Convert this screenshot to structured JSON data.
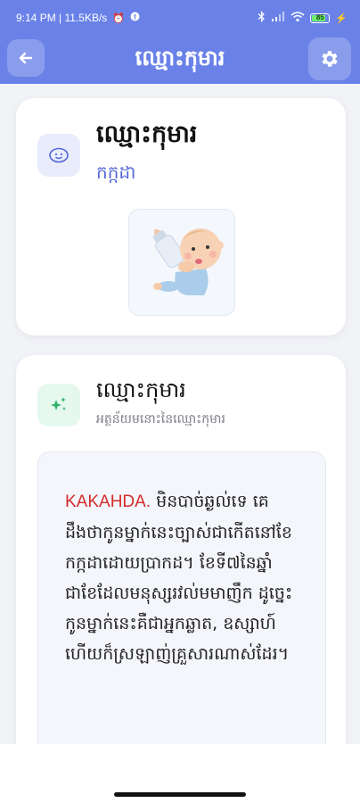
{
  "status_bar": {
    "left_text": "9:14 PM | 11.5KB/s",
    "battery_level": "85",
    "icons": [
      "alarm-icon",
      "facebook-icon",
      "bluetooth-icon",
      "signal-icon",
      "wifi-icon",
      "battery-icon",
      "charging-icon"
    ]
  },
  "app_bar": {
    "title": "ឈ្មោះកុមារ",
    "back_icon": "arrow-left-icon",
    "settings_icon": "gear-icon"
  },
  "name_card": {
    "name": "ឈ្មោះកុមារ",
    "month": "កក្កដា",
    "icon": "face-icon",
    "image": "baby-with-bottle"
  },
  "meaning_card": {
    "title": "ឈ្មោះកុមារ",
    "subtitle": "អត្ថន័យមនោះនៃឈ្មោះកុមារ",
    "icon": "sparkle-icon",
    "keyword": "KAKAHDA.",
    "text": " មិនបាច់ឆ្ងល់ទេ គេដឹងថាកូនម្នាក់នេះច្បាស់ជាកើតនៅខែកក្កដាដោយប្រាកដ។ ខែទី៧នៃឆ្នាំ ជាខែដែលមនុស្សរវល់មមាញឹក ដូច្នេះកូនម្នាក់នេះគឺជាអ្នកឆ្លាត, ឧស្សាហ៍ហើយក៏ស្រឡាញ់គ្រួសារណាស់ដែរ។"
  },
  "colors": {
    "primary": "#6a82e8",
    "accent_text": "#5468d8",
    "keyword": "#d42b2b",
    "background": "#f2f3f7"
  }
}
